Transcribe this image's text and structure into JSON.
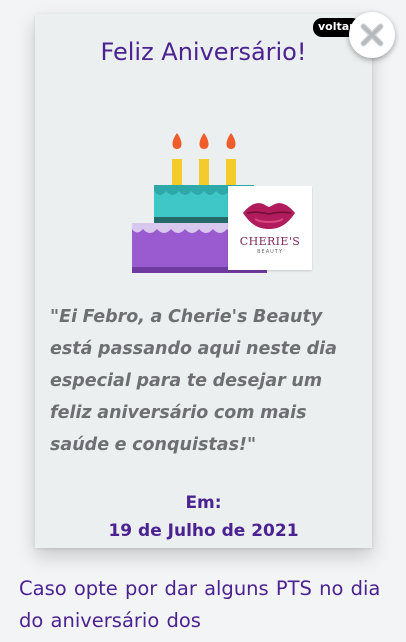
{
  "card": {
    "title": "Feliz Aniversário!",
    "message": "\"Ei Febro, a Cherie's Beauty está passando aqui neste dia especial para te desejar um feliz aniversário com mais saúde e conquistas!\"",
    "date_label": "Em:",
    "date_value": "19 de Julho de 2021"
  },
  "logo": {
    "name": "CHERIE'S",
    "subtitle": "BEAUTY",
    "icon": "lips-icon"
  },
  "cake": {
    "icon": "birthday-cake-icon",
    "candles": 3
  },
  "controls": {
    "voltar_label": "voltar",
    "close_icon": "close-icon"
  },
  "footer": {
    "text": "Caso opte por dar alguns PTS no dia do aniversário dos"
  },
  "colors": {
    "accent": "#4b2391",
    "message_text": "#6d6f72",
    "card_bg": "#eceff0",
    "cake_top": "#3fc7c8",
    "cake_bottom": "#9b5bd0",
    "candle": "#f3cb2b",
    "flame": "#f05c2a",
    "logo_lips": "#b01c5c"
  }
}
